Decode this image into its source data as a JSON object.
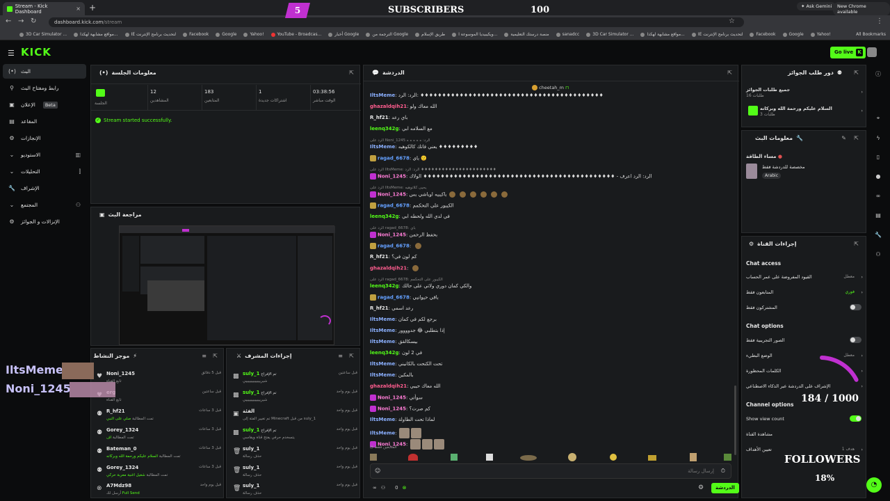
{
  "browser": {
    "tab_title": "Stream - Kick Dashboard",
    "url_host": "dashboard.kick.com",
    "url_path": "/stream",
    "ask_gemini": "Ask Gemini",
    "new_chrome": "New Chrome available",
    "all_bookmarks": "All Bookmarks",
    "bookmarks": [
      "3D Car Simulator ...",
      "مواقع مشابهة لهكذا...",
      "⁡IE لتحديث برنامج الإنترنت",
      "Facebook",
      "Google",
      "Yahoo!",
      "YouTube - Broadcas...",
      "أخبار Google",
      "الترجمة من Google",
      "طريق الإسلام",
      "ويكيبيديا الموسوعة ا...",
      "منصة درستك التعليمية",
      "sanadcc",
      "3D Car Simulator ...",
      "مواقع مشابهة لهكذا...",
      "⁡IE لتحديث برنامج الإنترنت",
      "Facebook",
      "Google",
      "Yahoo!"
    ]
  },
  "overlay": {
    "subs_count": "5",
    "subs_label": "SUBSCRIBERS",
    "subs_goal": "100",
    "name1": "IltsMeme",
    "name2": "Noni_1245",
    "followers_progress": "184 / 1000",
    "followers_label": "FOLLOWERS",
    "followers_percent": "18%",
    "followers_fraction": 0.18
  },
  "header": {
    "logo": "KICK",
    "go_live": "Go live"
  },
  "sidebar": {
    "items": [
      {
        "label": "البث",
        "icon": "(•)"
      },
      {
        "label": "رابط ومفتاح البث",
        "icon": "🔗"
      },
      {
        "label": "الإعلان",
        "icon": "▣",
        "badge": "Beta"
      },
      {
        "label": "المقاعد",
        "icon": "▤"
      },
      {
        "label": "الإنجازات",
        "icon": "⚙"
      },
      {
        "label": "الاستوديو",
        "icon": "⏷"
      },
      {
        "label": "التحليلات",
        "icon": "⏷"
      },
      {
        "label": "الإشراف",
        "icon": "🔧"
      },
      {
        "label": "المجتمع",
        "icon": "⏷"
      },
      {
        "label": "الإنزالات و الجوائز",
        "icon": "⚙"
      }
    ]
  },
  "session": {
    "title": "معلومات الجلسة",
    "stats": [
      {
        "value": "",
        "label": "الجلسة"
      },
      {
        "value": "12",
        "label": "المشاهدين"
      },
      {
        "value": "183",
        "label": "المتابعين"
      },
      {
        "value": "1",
        "label": "اشتراكات جديدة"
      },
      {
        "value": "03:38:56",
        "label": "الوقت مباشر"
      }
    ],
    "status": "Stream started successfully."
  },
  "preview": {
    "title": "مراجعة البث"
  },
  "activity": {
    "title": "موجز النشاط",
    "items": [
      {
        "name": "Noni_1245",
        "sub": "تابع القناة",
        "time": "قبل 5 دقائق"
      },
      {
        "name": "erg",
        "sub": "تابع القناة",
        "time": "قبل ساعتين"
      },
      {
        "name": "R_hf21",
        "sub": "تمت المطالبة",
        "hl": "صلي على النبي",
        "time": "قبل 3 ساعات"
      },
      {
        "name": "Gorey_1324",
        "sub": "تمت المطالبة",
        "hl": "اف",
        "time": "قبل 3 ساعات"
      },
      {
        "name": "Bateman_0",
        "sub": "تمت المطالبة",
        "hl": "السلام عليكم ورحمة الله وبركاته",
        "time": "قبل 3 ساعات"
      },
      {
        "name": "Gorey_1324",
        "sub": "تمت المطالبة",
        "hl": "شغيل اغنية معربة حركي",
        "time": "قبل 3 ساعات"
      },
      {
        "name": "A7Mdz98",
        "sub": "أرسل لك",
        "hl": "Full Send",
        "time": "قبل يوم واحد"
      }
    ]
  },
  "moderation": {
    "title": "إجراءات المشرف",
    "items": [
      {
        "user": "suly_1",
        "action": "تم الإفراج",
        "sub": "شيريييييييييييييي",
        "time": "قبل ساعتين"
      },
      {
        "user": "suly_1",
        "action": "تم الإفراج",
        "sub": "شيريييييييييييييي",
        "time": "قبل يوم واحد"
      },
      {
        "user": "",
        "action": "الفئة",
        "sub": "تم تغيير الفئة إلى Minecraft من قبل suly_1",
        "time": "قبل يوم واحد"
      },
      {
        "user": "suly_1",
        "action": "تم الإفراج",
        "sub": "يتسخدم حرفي يفتح قناة ويقاسي",
        "time": "قبل يوم واحد"
      },
      {
        "user": "suly_1",
        "action": "",
        "sub": "حذف رسالة",
        "time": "قبل يوم واحد"
      },
      {
        "user": "suly_1",
        "action": "",
        "sub": "حذف رسالة",
        "time": "قبل يوم واحد"
      },
      {
        "user": "suly_1",
        "action": "",
        "sub": "حذف رسالة",
        "time": "قبل يوم واحد"
      }
    ]
  },
  "chat": {
    "title": "الدردشة",
    "pinned_user": "cheetah_m",
    "placeholder": "إرسال رسالة",
    "send": "الدردشة",
    "count": "0",
    "followers_only": "المتابعين فقط",
    "messages": [
      {
        "reply": "",
        "user": "IltsMeme",
        "color": "#8bb0ff",
        "text": "الرد: الرد: ♦♦♦♦♦♦♦♦♦♦♦♦♦♦♦♦♦♦♦♦♦♦♦♦♦♦♦♦♦♦♦♦♦♦♦♦♦♦♦♦♦♦"
      },
      {
        "reply": "",
        "user": "ghazaldqih21",
        "color": "#ff5d8f",
        "text": "الله معاك ولو"
      },
      {
        "reply": "",
        "user": "R_hf21",
        "color": "#e8e8e8",
        "text": "باي رعد"
      },
      {
        "reply": "",
        "user": "leenq342g",
        "color": "#53fc18",
        "text": "مع السلامه ابي"
      },
      {
        "reply": "الرد على Noni_1245 الرد: ه ه ه ه ه",
        "user": "IltsMeme",
        "color": "#8bb0ff",
        "text": "يعني فاتك كالكوهيه ♦♦♦♦♦♦♦♦♦"
      },
      {
        "reply": "",
        "user": "ragad_6678",
        "color": "#64a0ff",
        "text": "باي 🙂",
        "badge": "#c0a040"
      },
      {
        "reply": "الرد على IltsMeme: الرد: الرد ♦♦♦♦♦♦♦♦♦♦♦♦♦♦♦♦♦♦♦♦♦♦",
        "user": "Noni_1245",
        "color": "#ff7dd6",
        "text": "الرد: الرد اعرف - ♦♦♦♦♦♦♦♦♦♦♦♦♦♦♦♦♦♦♦♦♦♦♦♦♦♦♦♦♦♦♦♦♦♦♦♦♦♦♦♦♦♦♦♦ الولاك",
        "badge": "#c030d0"
      },
      {
        "reply": "الرد على IltsMeme: يحيى كلاتوهيه",
        "user": "Noni_1245",
        "color": "#ff7dd6",
        "text": "باكيبيه اوباشي بس",
        "badge": "#c030d0",
        "emotes": 6
      },
      {
        "reply": "",
        "user": "ragad_6678",
        "color": "#64a0ff",
        "text": "الكيبور على التحكمم",
        "badge": "#c0a040"
      },
      {
        "reply": "",
        "user": "leenq342g",
        "color": "#53fc18",
        "text": "في لدي الله ولحطه ابي"
      },
      {
        "reply": "الرد على ragad_6678: باي",
        "user": "Noni_1245",
        "color": "#ff7dd6",
        "text": "بحفظ الرحمن",
        "badge": "#c030d0"
      },
      {
        "reply": "",
        "user": "ragad_6678",
        "color": "#64a0ff",
        "text": "",
        "badge": "#c0a040",
        "emotes": 1
      },
      {
        "reply": "",
        "user": "R_hf21",
        "color": "#e8e8e8",
        "text": "كم لون في؟"
      },
      {
        "reply": "",
        "user": "ghazaldqih21",
        "color": "#ff5d8f",
        "text": "",
        "emotes": 1
      },
      {
        "reply": "الرد على ragad_6678: الكيبور على التحكمم",
        "user": "leenq342g",
        "color": "#53fc18",
        "text": "والكي كمان دوري ولاتي على حالك"
      },
      {
        "reply": "",
        "user": "ragad_6678",
        "color": "#64a0ff",
        "text": "باقي حيوانيي",
        "badge": "#c0a040"
      },
      {
        "reply": "",
        "user": "R_hf21",
        "color": "#e8e8e8",
        "text": "رعد اسمي"
      },
      {
        "reply": "",
        "user": "IltsMeme",
        "color": "#8bb0ff",
        "text": "برجع لكم في كمان"
      },
      {
        "reply": "",
        "user": "IltsMeme",
        "color": "#8bb0ff",
        "text": "إذا بتطلبي 😂 جدوووور"
      },
      {
        "reply": "",
        "user": "IltsMeme",
        "color": "#8bb0ff",
        "text": "بيسكالقق"
      },
      {
        "reply": "",
        "user": "leenq342g",
        "color": "#53fc18",
        "text": "في 2 لون"
      },
      {
        "reply": "",
        "user": "IltsMeme",
        "color": "#8bb0ff",
        "text": "تحت الكتحت بالكانيني"
      },
      {
        "reply": "",
        "user": "IltsMeme",
        "color": "#8bb0ff",
        "text": "بالمكين"
      },
      {
        "reply": "",
        "user": "ghazaldqih21",
        "color": "#ff5d8f",
        "text": "الله معاك حيبي"
      },
      {
        "reply": "",
        "user": "Noni_1245",
        "color": "#ff7dd6",
        "text": "سوأتي",
        "badge": "#c030d0"
      },
      {
        "reply": "",
        "user": "Noni_1245",
        "color": "#ff7dd6",
        "text": "كم صرت؟",
        "badge": "#c030d0"
      },
      {
        "reply": "",
        "user": "IltsMeme",
        "color": "#8bb0ff",
        "text": "لماذا تحت الطاولة"
      },
      {
        "reply": "",
        "user": "IltsMeme",
        "color": "#8bb0ff",
        "text": "",
        "emimg": 2
      },
      {
        "reply": "",
        "user": "Noni_1245",
        "color": "#ff7dd6",
        "text": "",
        "badge": "#c030d0",
        "emimg": 3
      }
    ]
  },
  "rewards": {
    "title": "دور طلب الجوائز",
    "row1": "جميع طلبات الجوائز",
    "row1_sub": "طلبات 16",
    "row2": "السلام عليكم ورحمة الله وبركاته",
    "row2_sub": "طلبات 3"
  },
  "stream_info": {
    "title": "معلومات البث",
    "name": "مساء الطاقة",
    "category": "مخصصة للدردشة فقط",
    "language": "Arabic"
  },
  "channel": {
    "title": "إجراءات القناة",
    "chat_access": "Chat access",
    "access_rows": [
      {
        "label": "القيود المفروضة على عمر الحساب",
        "value": "معطل"
      },
      {
        "label": "المتابعون فقط",
        "value": "فوري"
      },
      {
        "label": "المشتركون فقط",
        "toggle": false
      }
    ],
    "chat_options": "Chat options",
    "option_rows": [
      {
        "label": "الصور التجريبية فقط",
        "toggle": false
      },
      {
        "label": "الوضع البطيء",
        "value": "معطل"
      },
      {
        "label": "الكلمات المحظورة",
        "value": ""
      },
      {
        "label": "الإشراف على الدردشة عبر الذكاء الاصطناعي",
        "value": ""
      }
    ],
    "channel_options": "Channel options",
    "show_view_count": "Show view count",
    "view_channel": "مشاهدة القناة",
    "set_goals": "تعيين الأهداف",
    "goal_value": "هدف 1"
  }
}
